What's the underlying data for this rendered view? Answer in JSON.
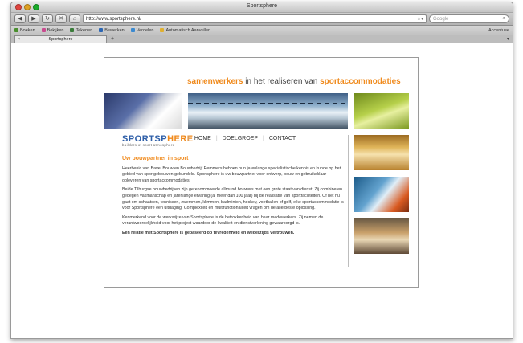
{
  "browser": {
    "window_title": "Sportsphere",
    "url": "http://www.sportsphere.nl/",
    "search_placeholder": "Google",
    "back_label": "◀",
    "forward_label": "▶",
    "reload_label": "↻",
    "home_label": "⌂",
    "stop_label": "✕",
    "bookmarks": [
      "Boeken",
      "Bekijken",
      "Tekenen",
      "Bewerken",
      "Verdelen",
      "Automatisch Aanvullen"
    ],
    "bookmarks_right": "Accentuee",
    "tab_label": "Sportsphere"
  },
  "site": {
    "tagline_part1": "samenwerkers",
    "tagline_part2": "in het realiseren van",
    "tagline_part3": "sportaccommodaties",
    "logo_part1": "SPORTSP",
    "logo_part2": "HERE",
    "logo_sub": "builders of sport atmosphere",
    "nav": [
      "HOME",
      "DOELGROEP",
      "CONTACT"
    ],
    "heading": "Uw bouwpartner in sport",
    "paragraphs": [
      "Heerbenic van Bavel Bouw en Bouwbedrijf Remmers hebben hun jarenlange specialistische kennis en kunde op het gebied van sportgebouwen gebundeld. Sportsphere is uw bouwpartner voor ontwerp, bouw en gebruiksklaar opleveren van sportaccommodaties.",
      "Beide Tilburgse bouwbedrijven zijn gerenommeerde allround bouwers met een grote staat van dienst. Zij combineren gedegen vakmanschap en jarenlange ervaring (al meer dan 100 jaar) bij de realisatie van sportfaciliteiten. Of het nu gaat om schaatsen, tennissen, zwemmen, klimmen, badminton, hockey, voetballen of golf, elke sportaccommodatie is voor Sportsphere een uitdaging. Complexiteit en multifunctionaliteit vragen om de allerbeste oplossing.",
      "Kenmerkend voor de werkwijze van Sportsphere is de betrokkenheid van haar medewerkers. Zij nemen de verantwoordelijkheid voor het project waardoor de kwaliteit en dienstverlening gewaarborgd is."
    ],
    "closing": "Een relatie met Sportsphere is gebaseerd op tevredenheid en wederzijds vertrouwen."
  },
  "colors": {
    "accent_orange": "#f08a1c",
    "logo_blue": "#2f5fa8"
  }
}
